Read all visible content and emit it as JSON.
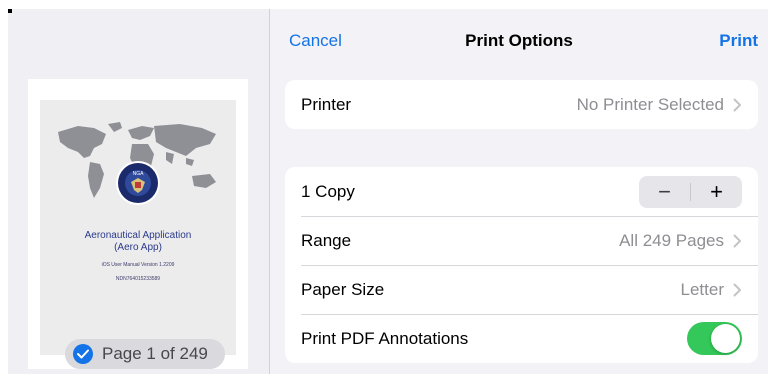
{
  "header": {
    "cancel_label": "Cancel",
    "title": "Print Options",
    "print_label": "Print"
  },
  "preview": {
    "doc_title_line1": "Aeronautical Application",
    "doc_title_line2": "(Aero App)",
    "doc_subtitle": "iOS User Manual Version 1.2209",
    "doc_code": "NDN764015233589",
    "seal_text": "NGA",
    "page_indicator": "Page 1 of 249",
    "selected": true
  },
  "printer": {
    "label": "Printer",
    "value": "No Printer Selected"
  },
  "options": {
    "copies_label": "1 Copy",
    "stepper_minus": "−",
    "stepper_plus": "+",
    "range_label": "Range",
    "range_value": "All 249 Pages",
    "paper_label": "Paper Size",
    "paper_value": "Letter",
    "annotations_label": "Print PDF Annotations",
    "annotations_on": true
  },
  "colors": {
    "accent": "#1473e6",
    "toggle_on": "#34c759",
    "secondary_text": "#8e8e93",
    "background": "#f2f2f7"
  },
  "icons": [
    "checkmark-circle-icon",
    "chevron-right-icon",
    "world-map-image",
    "agency-seal-logo"
  ]
}
